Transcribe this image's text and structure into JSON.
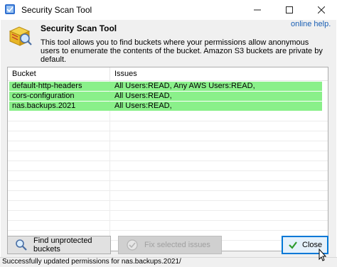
{
  "window": {
    "title": "Security Scan Tool",
    "controls": [
      "minimize-icon",
      "maximize-icon",
      "close-icon"
    ]
  },
  "header": {
    "title": "Security Scan Tool",
    "help_link": "online help.",
    "description": "This tool allows you to find buckets where your permissions allow anonymous users to enumerate the contents of the bucket. Amazon S3 buckets are private by default."
  },
  "list": {
    "columns": [
      "Bucket",
      "Issues"
    ],
    "rows": [
      {
        "bucket": "default-http-headers",
        "issues": "All Users:READ, Any AWS Users:READ,",
        "highlight": "#8af08a"
      },
      {
        "bucket": "cors-configuration",
        "issues": "All Users:READ,",
        "highlight": "#8af08a"
      },
      {
        "bucket": "nas.backups.2021",
        "issues": "All Users:READ,",
        "highlight": "#8af08a"
      }
    ]
  },
  "buttons": {
    "find": "Find unprotected buckets",
    "fix": "Fix selected issues",
    "close": "Close"
  },
  "status": {
    "text": "Successfully updated permissions for nas.backups.2021/"
  },
  "colors": {
    "row_highlight": "#8af08a",
    "link": "#1a5fb4",
    "focus": "#0078d7"
  }
}
